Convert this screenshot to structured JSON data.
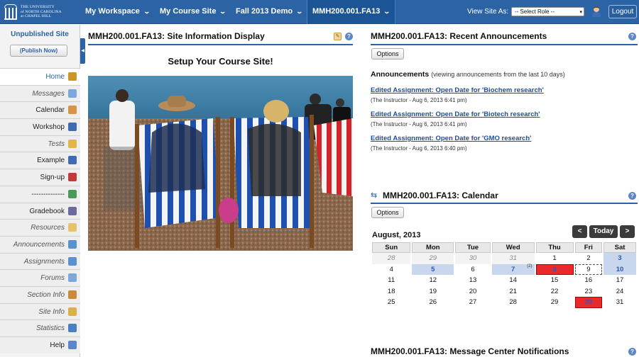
{
  "brand": {
    "line1": "THE UNIVERSITY",
    "line2": "of NORTH CAROLINA",
    "line3": "at CHAPEL HILL"
  },
  "nav": {
    "items": [
      {
        "label": "My Workspace"
      },
      {
        "label": "My Course Site"
      },
      {
        "label": "Fall 2013 Demo"
      },
      {
        "label": "MMH200.001.FA13"
      }
    ],
    "view_site_as": "View Site As:",
    "role_select_value": "-- Select Role --",
    "logout_label": "Logout"
  },
  "sidebar": {
    "site_status": "Unpublished Site",
    "publish_label": "(Publish Now)",
    "items": [
      {
        "label": "Home",
        "icon": "home-icon",
        "color": "#c9962b"
      },
      {
        "label": "Messages",
        "icon": "speech-bubble-icon",
        "color": "#7fa6db"
      },
      {
        "label": "Calendar",
        "icon": "calendar-icon",
        "color": "#d8934a"
      },
      {
        "label": "Workshop",
        "icon": "book-icon",
        "color": "#3f6bb0"
      },
      {
        "label": "Tests",
        "icon": "pencil-icon",
        "color": "#e3b54a"
      },
      {
        "label": "Example",
        "icon": "book-icon",
        "color": "#3f6bb0"
      },
      {
        "label": "Sign-up",
        "icon": "signup-icon",
        "color": "#c03a3a"
      },
      {
        "label": "--------------",
        "icon": "globe-icon",
        "color": "#4a9a5a"
      },
      {
        "label": "Gradebook",
        "icon": "gradebook-icon",
        "color": "#6b6b9e"
      },
      {
        "label": "Resources",
        "icon": "folder-icon",
        "color": "#e6c36a"
      },
      {
        "label": "Announcements",
        "icon": "megaphone-icon",
        "color": "#5a8fd0"
      },
      {
        "label": "Assignments",
        "icon": "assignment-icon",
        "color": "#5a8fd0"
      },
      {
        "label": "Forums",
        "icon": "forums-icon",
        "color": "#7fa6db"
      },
      {
        "label": "Section Info",
        "icon": "people-icon",
        "color": "#c98a3a"
      },
      {
        "label": "Site Info",
        "icon": "site-info-icon",
        "color": "#d9b04a"
      },
      {
        "label": "Statistics",
        "icon": "bar-chart-icon",
        "color": "#4a7fc0"
      },
      {
        "label": "Help",
        "icon": "help-icon",
        "color": "#5b86c8"
      }
    ]
  },
  "site_info": {
    "title": "MMH200.001.FA13: Site Information Display",
    "setup_heading": "Setup Your Course Site!"
  },
  "announcements": {
    "title": "MMH200.001.FA13: Recent Announcements",
    "options_label": "Options",
    "heading": "Announcements",
    "heading_note": "(viewing announcements from the last 10 days)",
    "items": [
      {
        "title": "Edited Assignment: Open Date for 'Biochem research'",
        "meta": "(The Instructor - Aug 6, 2013 6:41 pm)"
      },
      {
        "title": "Edited Assignment: Open Date for 'Biotech research'",
        "meta": "(The Instructor - Aug 6, 2013 6:41 pm)"
      },
      {
        "title": "Edited Assignment: Open Date for 'GMO research'",
        "meta": "(The Instructor - Aug 6, 2013 6:40 pm)"
      }
    ]
  },
  "calendar": {
    "title": "MMH200.001.FA13: Calendar",
    "options_label": "Options",
    "month": "August, 2013",
    "prev_label": "<",
    "today_label": "Today",
    "next_label": ">",
    "weekdays": [
      "Sun",
      "Mon",
      "Tue",
      "Wed",
      "Thu",
      "Fri",
      "Sat"
    ],
    "weeks": [
      [
        {
          "d": "28",
          "t": "other"
        },
        {
          "d": "29",
          "t": "other"
        },
        {
          "d": "30",
          "t": "other"
        },
        {
          "d": "31",
          "t": "other"
        },
        {
          "d": "1"
        },
        {
          "d": "2"
        },
        {
          "d": "3",
          "t": "ev"
        }
      ],
      [
        {
          "d": "4"
        },
        {
          "d": "5",
          "t": "ev"
        },
        {
          "d": "6"
        },
        {
          "d": "7",
          "t": "ev",
          "sup": "(2)"
        },
        {
          "d": "8",
          "t": "red"
        },
        {
          "d": "9",
          "t": "today"
        },
        {
          "d": "10",
          "t": "ev"
        }
      ],
      [
        {
          "d": "11"
        },
        {
          "d": "12"
        },
        {
          "d": "13"
        },
        {
          "d": "14"
        },
        {
          "d": "15"
        },
        {
          "d": "16"
        },
        {
          "d": "17"
        }
      ],
      [
        {
          "d": "18"
        },
        {
          "d": "19"
        },
        {
          "d": "20"
        },
        {
          "d": "21"
        },
        {
          "d": "22"
        },
        {
          "d": "23"
        },
        {
          "d": "24"
        }
      ],
      [
        {
          "d": "25"
        },
        {
          "d": "26"
        },
        {
          "d": "27"
        },
        {
          "d": "28"
        },
        {
          "d": "29"
        },
        {
          "d": "30",
          "t": "red"
        },
        {
          "d": "31"
        }
      ]
    ]
  },
  "message_center": {
    "title": "MMH200.001.FA13: Message Center Notifications"
  }
}
